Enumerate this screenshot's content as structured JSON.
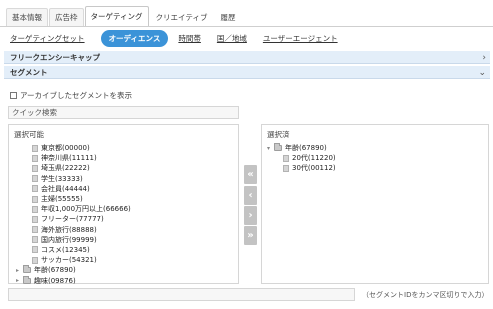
{
  "top_tabs": [
    {
      "label": "基本情報",
      "active": false
    },
    {
      "label": "広告枠",
      "active": false
    },
    {
      "label": "ターゲティング",
      "active": true
    },
    {
      "label": "クリエイティブ",
      "active": false
    },
    {
      "label": "履歴",
      "active": false
    }
  ],
  "sub_tabs": [
    {
      "label": "ターゲティングセット",
      "active": false
    },
    {
      "label": "オーディエンス",
      "active": true
    },
    {
      "label": "時間帯",
      "active": false
    },
    {
      "label": "国／地域",
      "active": false
    },
    {
      "label": "ユーザーエージェント",
      "active": false
    }
  ],
  "sections": {
    "frequency_cap": {
      "label": "フリークエンシーキャップ",
      "chevron": "›"
    },
    "segment": {
      "label": "セグメント",
      "chevron": "⌄"
    }
  },
  "archive_checkbox": {
    "label": "アーカイブしたセグメントを表示",
    "checked": false
  },
  "quick_search": {
    "placeholder": "クイック検索"
  },
  "available": {
    "title": "選択可能",
    "items": [
      "東京都(00000)",
      "神奈川県(11111)",
      "埼玉県(22222)",
      "学生(33333)",
      "会社員(44444)",
      "主婦(55555)",
      "年収1,000万円以上(66666)",
      "フリーター(77777)",
      "海外旅行(88888)",
      "国内旅行(99999)",
      "コスメ(12345)",
      "サッカー(54321)"
    ],
    "folders": [
      "年齢(67890)",
      "趣味(09876)"
    ]
  },
  "selected": {
    "title": "選択済",
    "folder": "年齢(67890)",
    "children": [
      "20代(11220)",
      "30代(00112)"
    ]
  },
  "transfer_buttons": [
    "«",
    "‹",
    "›",
    "»"
  ],
  "segment_ids": {
    "hint": "（セグメントIDをカンマ区切りで入力）",
    "value": ""
  }
}
